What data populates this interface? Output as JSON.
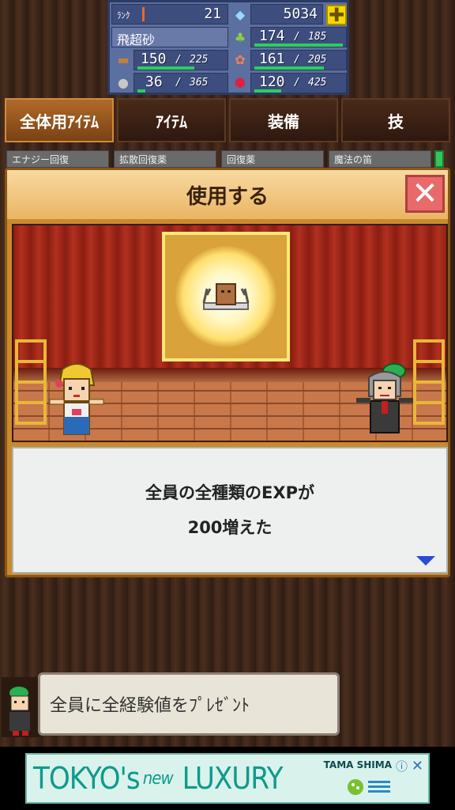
{
  "status": {
    "rank_label": "ﾗﾝｸ",
    "rank_value": "21",
    "gems_value": "5034",
    "name": "飛超砂",
    "stat_green": {
      "value": "174",
      "max": "185"
    },
    "stat_wood": {
      "value": "150",
      "max": "225"
    },
    "stat_veg": {
      "value": "161",
      "max": "205"
    },
    "stat_ore": {
      "value": "36",
      "max": "365"
    },
    "stat_ruby": {
      "value": "120",
      "max": "425"
    },
    "sep": "/"
  },
  "tabs": [
    {
      "label": "全体用ｱｲﾃﾑ"
    },
    {
      "label": "ｱｲﾃﾑ"
    },
    {
      "label": "装備"
    },
    {
      "label": "技"
    }
  ],
  "subtabs": [
    "エナジー回復",
    "拡散回復薬",
    "回復薬",
    "魔法の笛"
  ],
  "dialog": {
    "title": "使用する",
    "message_line1": "全員の全種類のEXPが",
    "message_line2": "200増えた"
  },
  "advisor": {
    "text": "全員に全経験値をﾌﾟﾚｾﾞﾝﾄ"
  },
  "ad": {
    "text_left": "TOKYO's",
    "text_new": "new",
    "text_right": "LUXURY",
    "brand": "TAMA SHIMA",
    "close": "✕",
    "info": "ⓘ"
  },
  "colors": {
    "accent_green": "#2ad05c",
    "dialog_orange": "#c98a2e",
    "curtain_red": "#b2301e"
  }
}
